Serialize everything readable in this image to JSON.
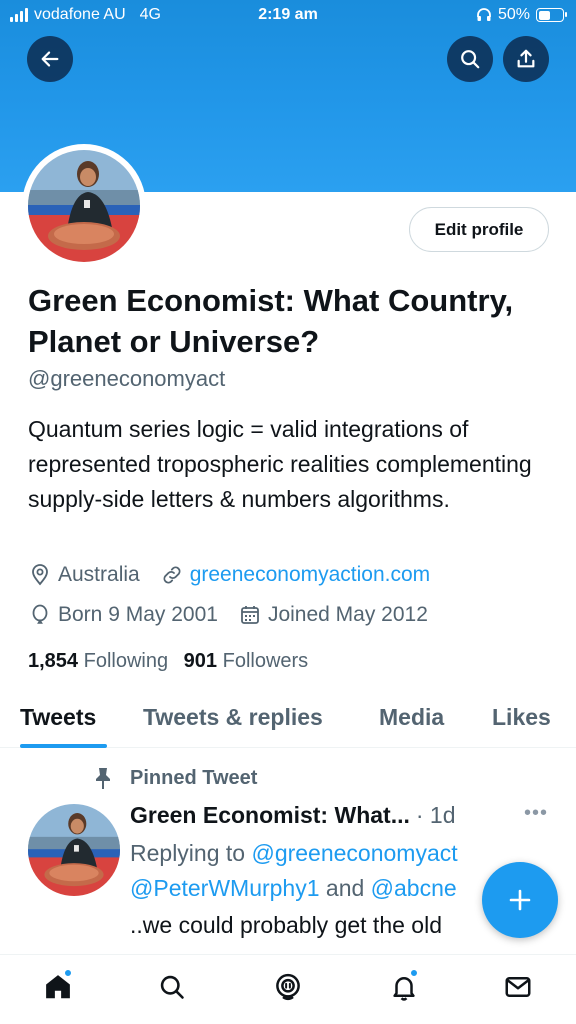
{
  "status_bar": {
    "carrier": "vodafone AU",
    "network": "4G",
    "time": "2:19 am",
    "battery": "50%",
    "battery_level": 0.5
  },
  "header": {
    "back_icon": "arrow-left-icon",
    "search_icon": "search-icon",
    "share_icon": "share-icon"
  },
  "profile": {
    "edit_button_label": "Edit profile",
    "name": "Green Economist: What Country, Planet or Universe?",
    "handle": "@greeneconomyact",
    "bio": "Quantum series logic = valid integrations of represented tropospheric realities complementing supply-side letters & numbers algorithms.",
    "location": "Australia",
    "website": "greeneconomyaction.com",
    "born": "Born 9 May 2001",
    "joined": "Joined May 2012",
    "following_count": "1,854",
    "following_label": "Following",
    "followers_count": "901",
    "followers_label": "Followers"
  },
  "tabs": [
    {
      "label": "Tweets",
      "active": true
    },
    {
      "label": "Tweets & replies",
      "active": false
    },
    {
      "label": "Media",
      "active": false
    },
    {
      "label": "Likes",
      "active": false
    }
  ],
  "tweet": {
    "pinned_label": "Pinned Tweet",
    "author": "Green Economist: What...",
    "time": "· 1d",
    "replying_prefix": "Replying to ",
    "mention1": "@greeneconomyact",
    "mention2": "@PeterWMurphy1",
    "and_text": " and ",
    "mention3": "@abcne",
    "text": "..we could probably get the old"
  },
  "colors": {
    "accent": "#1d9bf0",
    "banner": "#2196e8",
    "text_secondary": "#536471"
  },
  "bottom_nav": [
    {
      "icon": "home-icon",
      "badge": true
    },
    {
      "icon": "search-icon",
      "badge": false
    },
    {
      "icon": "spaces-icon",
      "badge": false
    },
    {
      "icon": "notifications-icon",
      "badge": true
    },
    {
      "icon": "messages-icon",
      "badge": false
    }
  ]
}
